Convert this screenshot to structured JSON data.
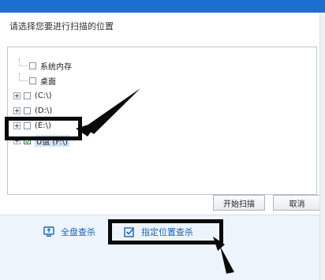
{
  "dialog": {
    "title": "请选择您要进行扫描的位置",
    "tree_items": [
      {
        "label": "系统内存",
        "checked": false,
        "expandable": false
      },
      {
        "label": "桌面",
        "checked": false,
        "expandable": false
      },
      {
        "label": "(C:\\)",
        "checked": false,
        "expandable": true
      },
      {
        "label": "(D:\\)",
        "checked": false,
        "expandable": true
      },
      {
        "label": "(E:\\)",
        "checked": false,
        "expandable": true
      },
      {
        "label": "U盘 (F:\\)",
        "checked": true,
        "expandable": true,
        "selected": true
      }
    ],
    "start_scan_label": "开始扫描",
    "cancel_label": "取消"
  },
  "tabs": {
    "full_scan_label": "全盘查杀",
    "custom_scan_label": "指定位置查杀"
  },
  "colors": {
    "accent": "#1a64b4",
    "band": "#1b6fd1",
    "check": "#2e7d32"
  }
}
